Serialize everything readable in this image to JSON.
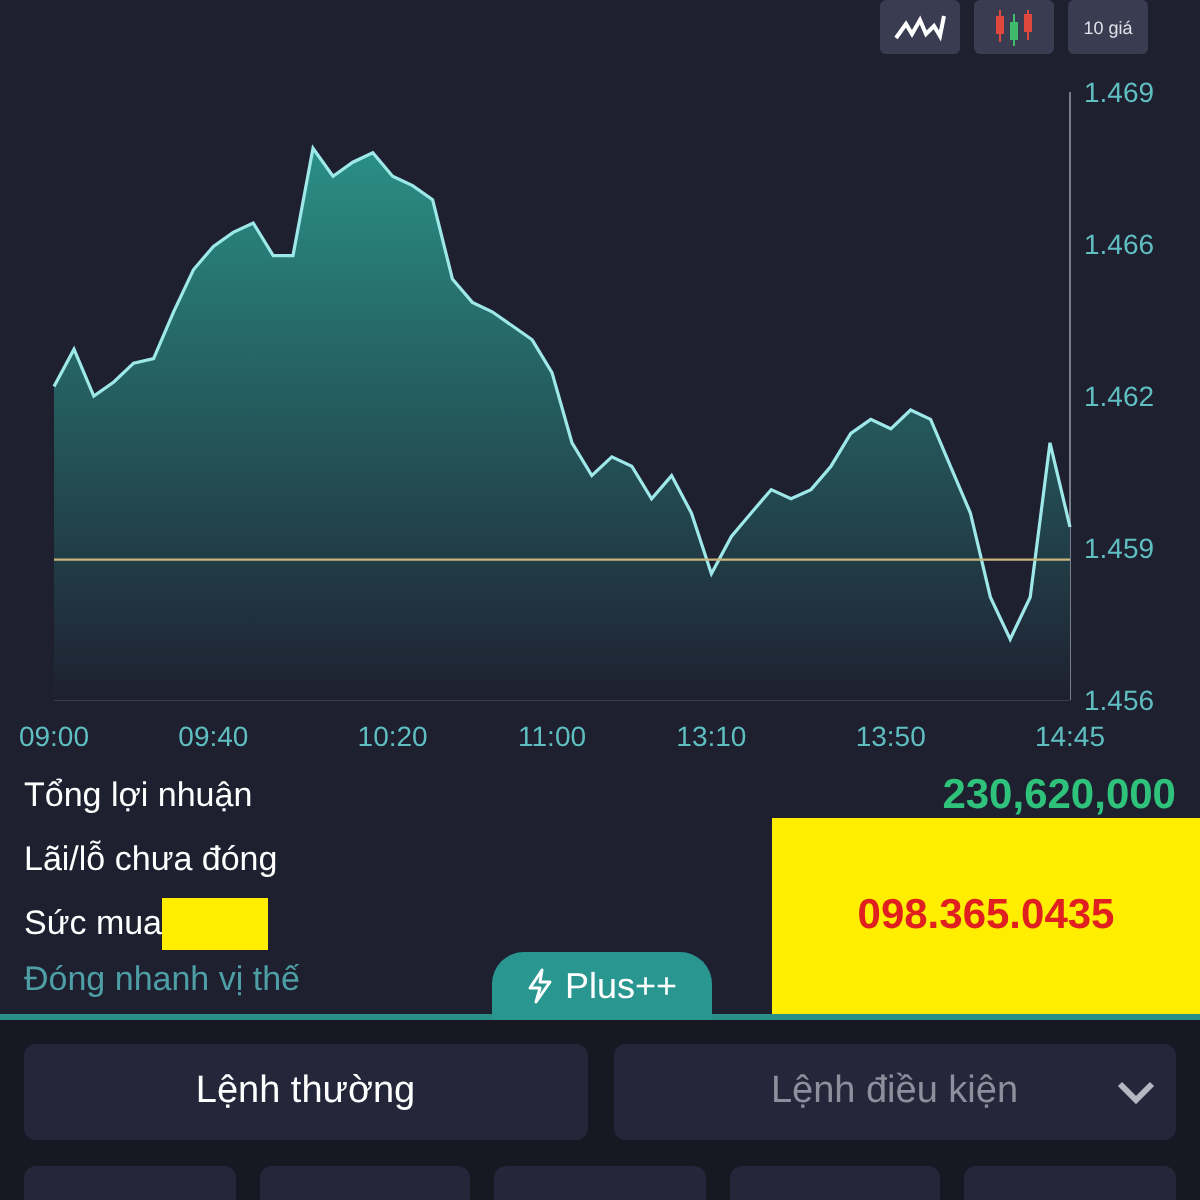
{
  "toolbar": [
    {
      "kind": "line"
    },
    {
      "kind": "candles"
    },
    {
      "kind": "text",
      "label": "10 giá"
    }
  ],
  "chart": {
    "chart_data": {
      "type": "area",
      "categories": [
        "09:00",
        null,
        null,
        null,
        null,
        null,
        null,
        null,
        "09:40",
        null,
        null,
        null,
        null,
        null,
        null,
        null,
        null,
        "10:20",
        null,
        null,
        null,
        null,
        null,
        null,
        null,
        "11:00",
        null,
        null,
        null,
        null,
        null,
        null,
        null,
        "13:10",
        null,
        null,
        null,
        null,
        null,
        null,
        null,
        null,
        "13:50",
        null,
        null,
        null,
        null,
        null,
        null,
        null,
        null,
        "14:45"
      ],
      "series": [
        {
          "color": "#9ee8ea",
          "values": [
            1.4627,
            1.4635,
            1.4625,
            1.4628,
            1.4632,
            1.4633,
            1.4643,
            1.4652,
            1.4657,
            1.466,
            1.4662,
            1.4655,
            1.4655,
            1.4678,
            1.4672,
            1.4675,
            1.4677,
            1.4672,
            1.467,
            1.4667,
            1.465,
            1.4645,
            1.4643,
            1.464,
            1.4637,
            1.463,
            1.4615,
            1.4608,
            1.4612,
            1.461,
            1.4603,
            1.4608,
            1.46,
            1.4587,
            1.4595,
            1.46,
            1.4605,
            1.4603,
            1.4605,
            1.461,
            1.4617,
            1.462,
            1.4618,
            1.4622,
            1.462,
            1.461,
            1.46,
            1.4582,
            1.4573,
            1.4582,
            1.4615,
            1.4597
          ]
        },
        {
          "type": "line",
          "color": "#c9b57a",
          "values": [
            1.459,
            1.459,
            1.459,
            1.459,
            1.459,
            1.459,
            1.459,
            1.459,
            1.459,
            1.459,
            1.459,
            1.459,
            1.459,
            1.459,
            1.459,
            1.459,
            1.459,
            1.459,
            1.459,
            1.459,
            1.459,
            1.459,
            1.459,
            1.459,
            1.459,
            1.459,
            1.459,
            1.459,
            1.459,
            1.459,
            1.459,
            1.459,
            1.459,
            1.459,
            1.459,
            1.459,
            1.459,
            1.459,
            1.459,
            1.459,
            1.459,
            1.459,
            1.459,
            1.459,
            1.459,
            1.459,
            1.459,
            1.459,
            1.459,
            1.459,
            1.459,
            1.459
          ]
        }
      ],
      "ylim": [
        1.456,
        1.469
      ],
      "yticks": [
        {
          "value": 1.469,
          "label": "1.469"
        },
        {
          "value": 1.46575,
          "label": "1.466"
        },
        {
          "value": 1.4625,
          "label": "1.462"
        },
        {
          "value": 1.45925,
          "label": "1.459"
        },
        {
          "value": 1.456,
          "label": "1.456"
        }
      ],
      "stacked": false
    }
  },
  "summary": [
    {
      "label": "Tổng lợi nhuận",
      "value": "230,620,000"
    },
    {
      "label": "Lãi/lỗ chưa đóng"
    },
    {
      "label": "Sức mua",
      "redacted": true
    }
  ],
  "quick_close": "Đóng nhanh vị thế",
  "overlay": {
    "text": "098.365.0435"
  },
  "plus_tab": "Plus++",
  "order_tabs": [
    {
      "label": "Lệnh thường",
      "selected": true
    },
    {
      "label": "Lệnh điều kiện",
      "selected": false,
      "dropdown": true
    }
  ]
}
